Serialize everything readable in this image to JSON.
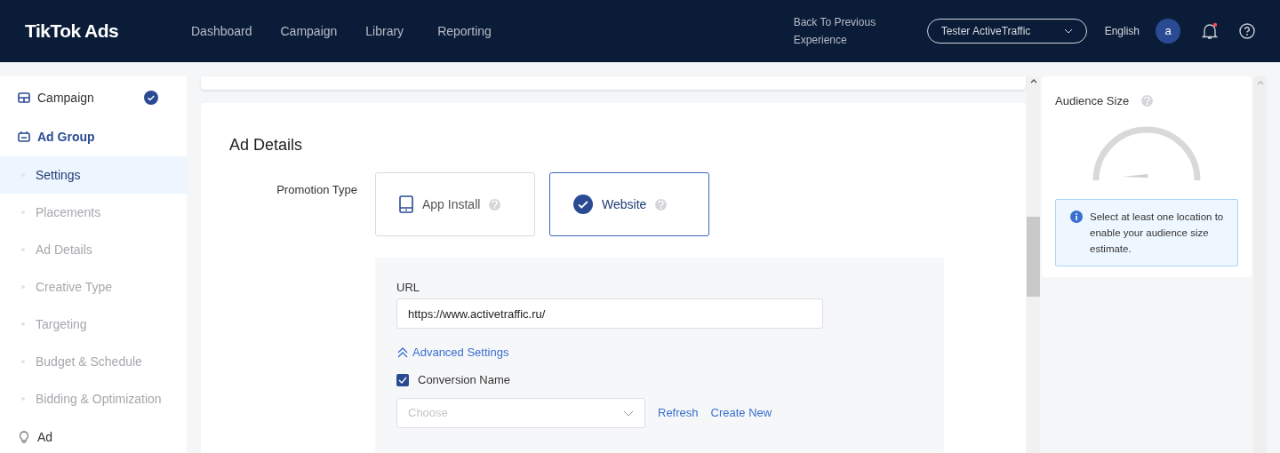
{
  "header": {
    "logo": "TikTok Ads",
    "nav": [
      {
        "label": "Dashboard",
        "selected": false
      },
      {
        "label": "Campaign",
        "selected": false
      },
      {
        "label": "Library",
        "selected": false
      },
      {
        "label": "Reporting",
        "selected": false
      }
    ],
    "back_link": "Back To Previous Experience",
    "account": "Tester ActiveTraffic",
    "language": "English",
    "avatar": "a",
    "notification_dot": true
  },
  "sidebar": {
    "items": [
      {
        "kind": "section",
        "label": "Campaign",
        "selected": false,
        "completed": true
      },
      {
        "kind": "section",
        "label": "Ad Group",
        "selected": true,
        "completed": false
      },
      {
        "kind": "step",
        "label": "Settings",
        "selected": true
      },
      {
        "kind": "step",
        "label": "Placements",
        "selected": false
      },
      {
        "kind": "step",
        "label": "Ad Details",
        "selected": false
      },
      {
        "kind": "step",
        "label": "Creative Type",
        "selected": false
      },
      {
        "kind": "step",
        "label": "Targeting",
        "selected": false
      },
      {
        "kind": "step",
        "label": "Budget & Schedule",
        "selected": false
      },
      {
        "kind": "step",
        "label": "Bidding & Optimization",
        "selected": false
      },
      {
        "kind": "section",
        "label": "Ad",
        "selected": false,
        "completed": false
      }
    ]
  },
  "ad_details": {
    "title": "Ad Details",
    "promotion_type": {
      "label": "Promotion Type",
      "options": [
        {
          "label": "App Install",
          "selected": false
        },
        {
          "label": "Website",
          "selected": true
        }
      ]
    },
    "url": {
      "label": "URL",
      "value": "https://www.activetraffic.ru/"
    },
    "advanced": {
      "label": "Advanced Settings",
      "expanded": true
    },
    "conversion": {
      "label": "Conversion Name",
      "checked": true,
      "placeholder": "Choose",
      "actions": [
        "Refresh",
        "Create New"
      ]
    }
  },
  "audience": {
    "title": "Audience Size",
    "message": "Select at least one location to enable your audience size estimate."
  }
}
